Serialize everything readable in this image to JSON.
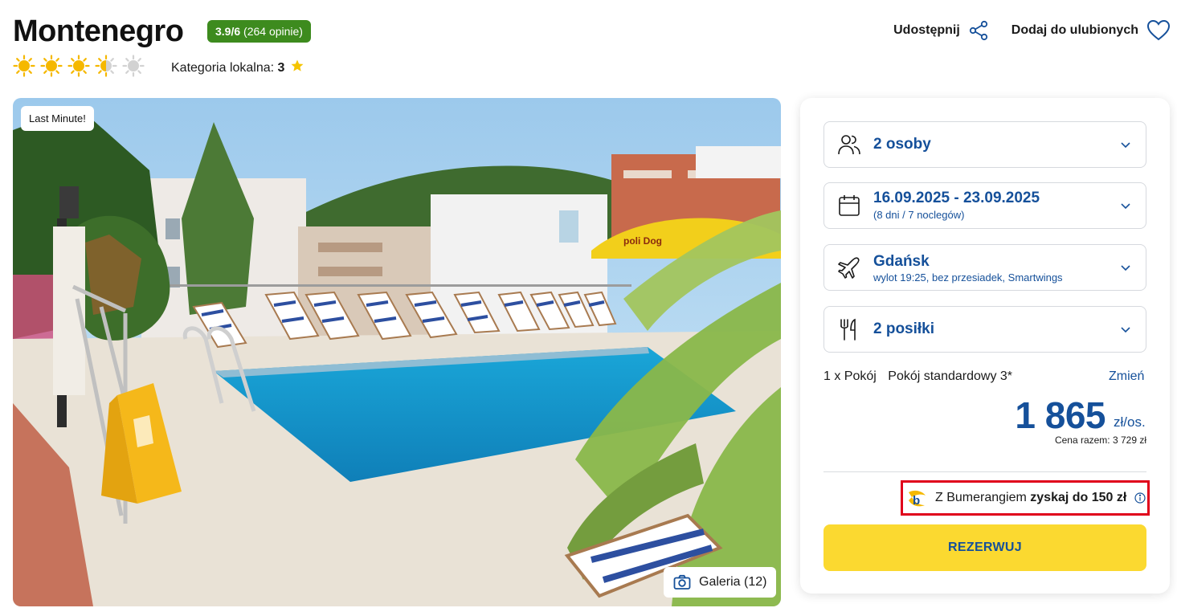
{
  "header": {
    "title": "Montenegro",
    "rating_score": "3.9/6",
    "rating_reviews": "(264 opinie)",
    "sun_rating": 3.5,
    "sun_max": 5,
    "local_category_label": "Kategoria lokalna:",
    "local_category_value": "3",
    "share_label": "Udostępnij",
    "favorite_label": "Dodaj do ulubionych"
  },
  "photo": {
    "badge": "Last Minute!",
    "gallery_label": "Galeria (12)",
    "umbrella_text": "poli Dog"
  },
  "booking": {
    "guests": {
      "label": "2 osoby",
      "icon": "people-icon"
    },
    "dates": {
      "label": "16.09.2025 - 23.09.2025",
      "sub": "(8 dni / 7 noclegów)",
      "icon": "calendar-icon"
    },
    "departure": {
      "label": "Gdańsk",
      "sub": "wylot 19:25, bez przesiadek, Smartwings",
      "icon": "plane-icon"
    },
    "meals": {
      "label": "2 posiłki",
      "icon": "fork-knife-icon"
    },
    "room_count": "1 x Pokój",
    "room_type": "Pokój standardowy 3*",
    "change_label": "Zmień",
    "price": "1 865",
    "price_unit": "zł/os.",
    "total_label": "Cena razem: 3 729 zł",
    "bumerang_prefix": "Z Bumerangiem",
    "bumerang_highlight": "zyskaj do 150 zł",
    "reserve_label": "REZERWUJ"
  },
  "colors": {
    "brand_blue": "#15509a",
    "rating_green": "#3d8b1e",
    "cta_yellow": "#fbd930",
    "highlight_red": "#e0001b",
    "sun_yellow": "#f5b800"
  }
}
